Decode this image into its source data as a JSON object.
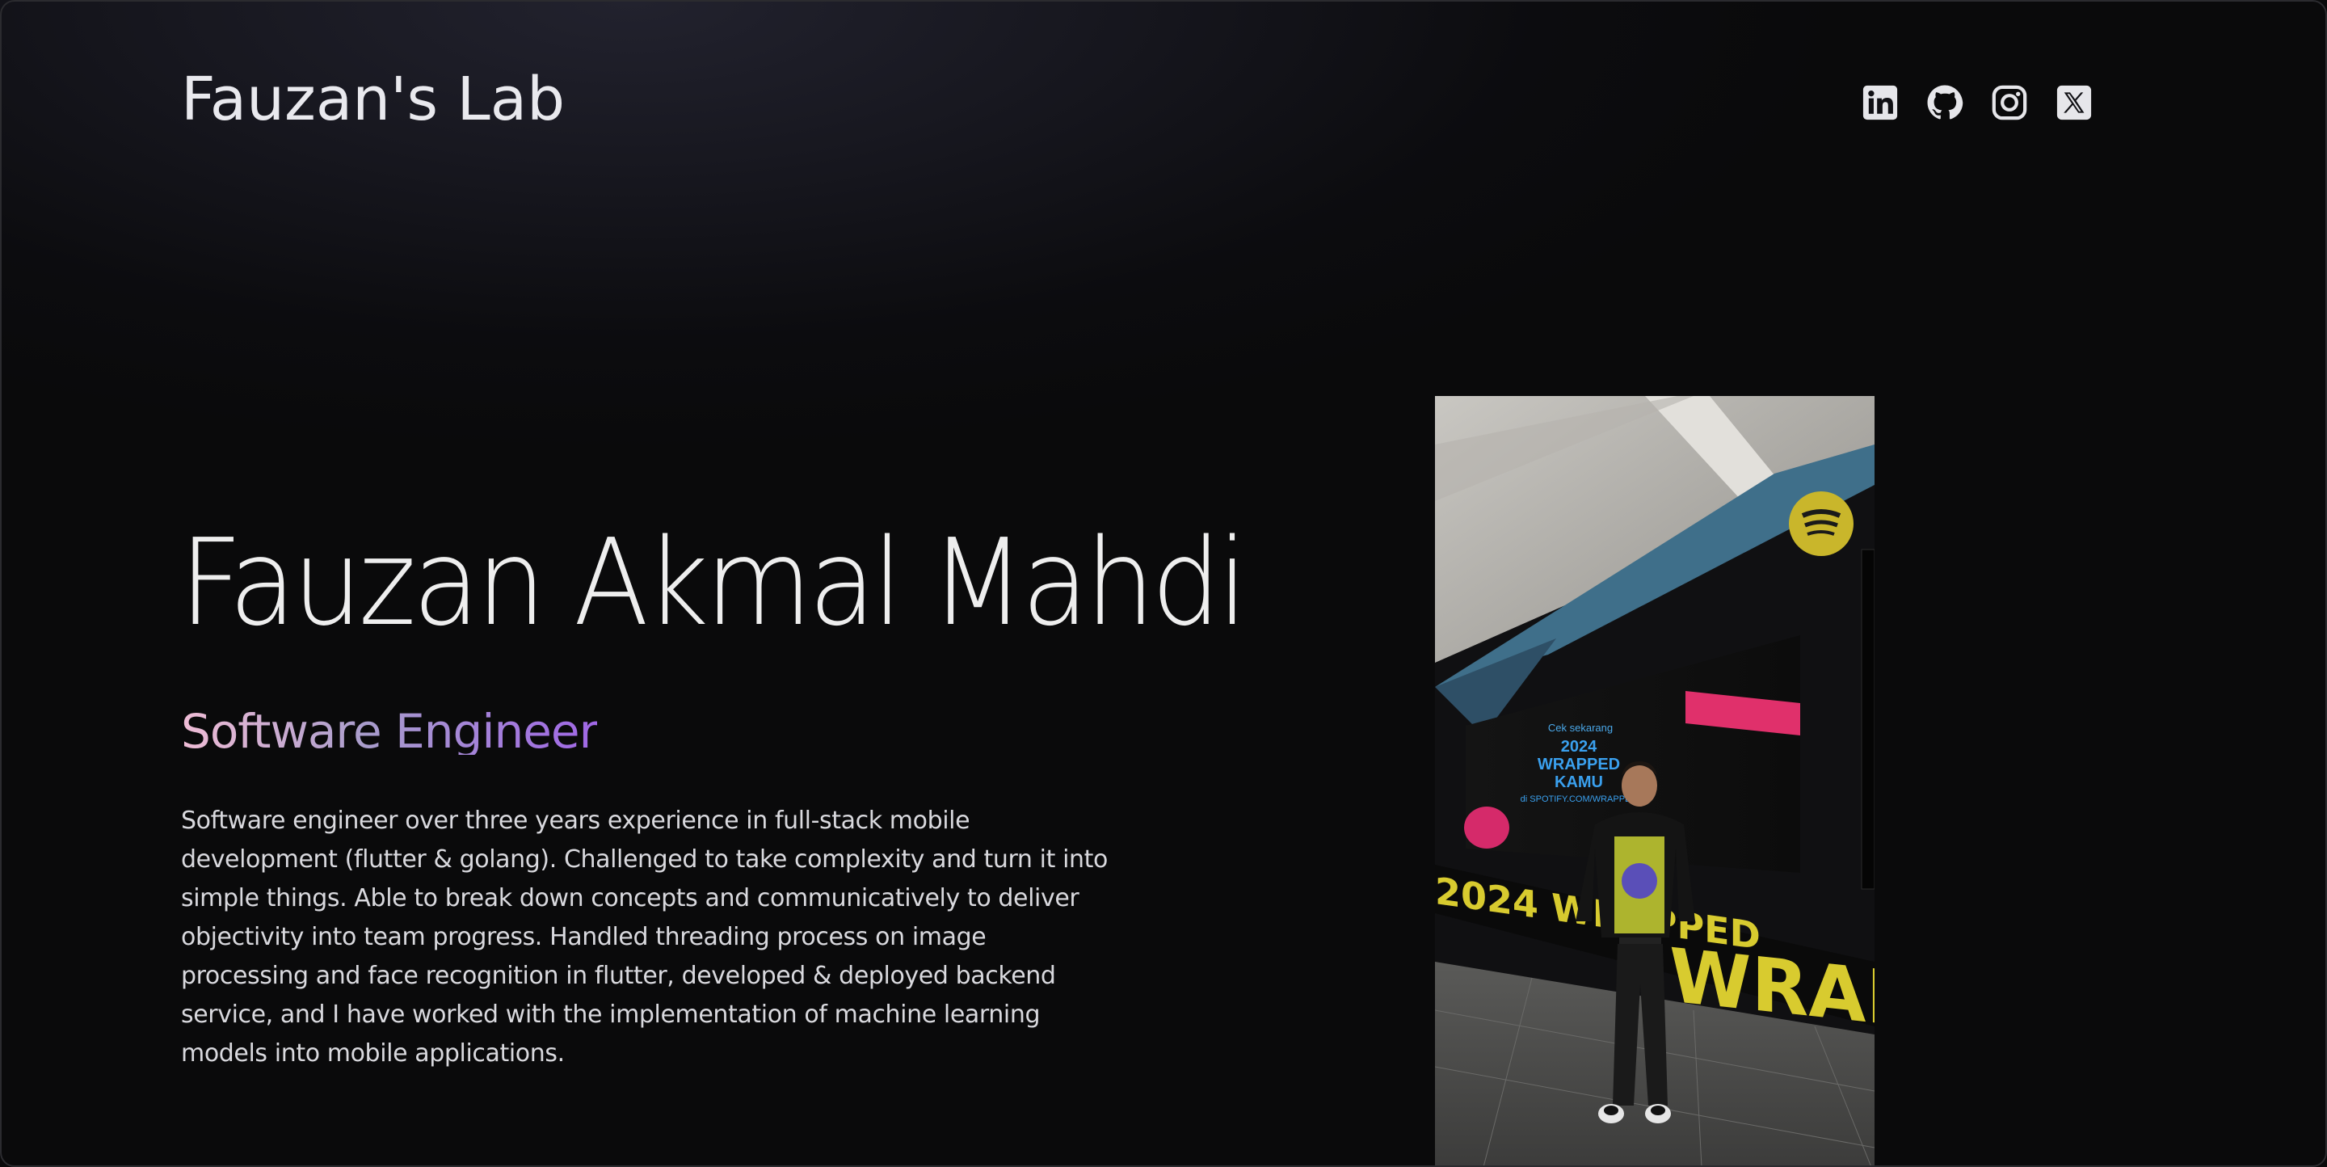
{
  "header": {
    "brand": "Fauzan's Lab",
    "social_links": [
      {
        "icon": "linkedin-icon"
      },
      {
        "icon": "github-icon"
      },
      {
        "icon": "instagram-icon"
      },
      {
        "icon": "x-twitter-icon"
      }
    ]
  },
  "hero": {
    "name": "Fauzan Akmal Mahdi",
    "role": "Software Engineer",
    "bio": "Software engineer over three years experience in full-stack mobile development (flutter & golang). Challenged to take complexity and turn it into simple things. Able to break down concepts and communicatively to deliver objectivity into team progress. Handled threading process on image processing and face recognition in flutter, developed & deployed backend service, and I have worked with the implementation of machine learning models into mobile applications."
  },
  "photo": {
    "screen_text": {
      "line1": "Cek sekarang",
      "line2": "2024",
      "line3": "WRAPPED",
      "line4": "KAMU",
      "line5": "di SPOTIFY.COM/WRAPPED"
    },
    "wall_text": "2024 WRAPPED",
    "wall_text_large": "WRAP"
  },
  "colors": {
    "background": "#0b0b0d",
    "role_gradient_start": "#f0bdd6",
    "role_gradient_end": "#a067e6",
    "text": "#e6e6ea"
  }
}
